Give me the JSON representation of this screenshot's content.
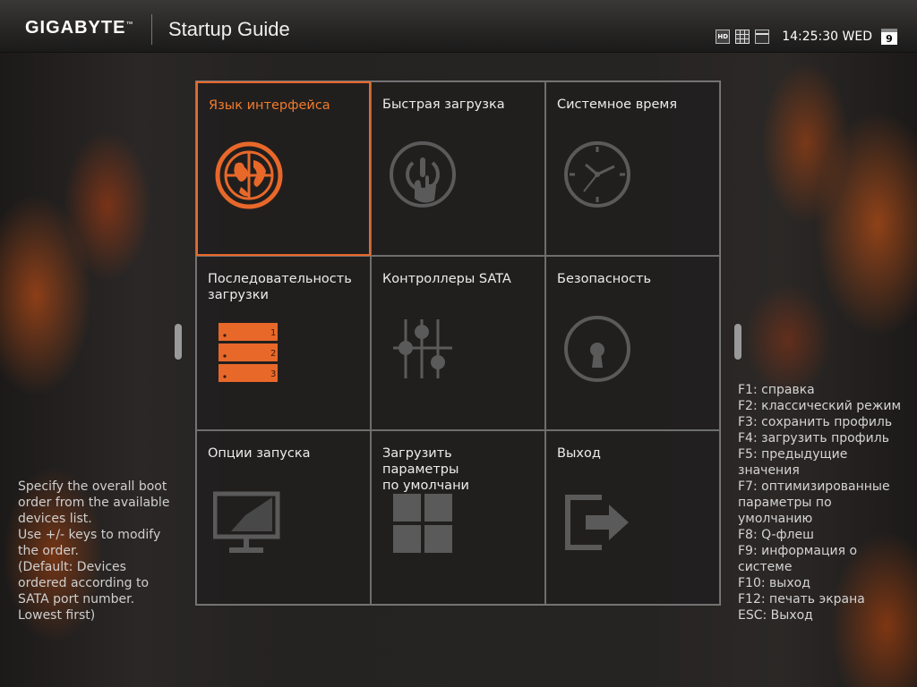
{
  "header": {
    "brand": "GIGABYTE",
    "brand_mark": "™",
    "title": "Startup Guide",
    "clock": "14:25:30 WED",
    "day": "9",
    "icons": [
      "hd-icon",
      "grid-view-icon",
      "window-view-icon",
      "calendar-icon"
    ]
  },
  "tiles": [
    {
      "label": "Язык интерфейса",
      "icon": "globe-icon"
    },
    {
      "label": "Быстрая загрузка",
      "icon": "power-touch-icon"
    },
    {
      "label": "Системное время",
      "icon": "clock-icon"
    },
    {
      "label": "Последовательность загрузки",
      "icon": "boot-order-icon",
      "order": [
        "1",
        "2",
        "3"
      ]
    },
    {
      "label": "Контроллеры SATA",
      "icon": "sliders-icon"
    },
    {
      "label": "Безопасность",
      "icon": "keyhole-icon"
    },
    {
      "label": "Опции запуска",
      "icon": "monitor-icon"
    },
    {
      "label": "Загрузить\nпараметры\nпо умолчани",
      "icon": "windows-icon"
    },
    {
      "label": "Выход",
      "icon": "exit-icon"
    }
  ],
  "help_text": "Specify the overall boot\norder from the available\ndevices list.\nUse +/- keys to modify\nthe order.\n(Default: Devices\nordered according to\nSATA port number.\nLowest first)",
  "hotkeys": [
    "F1: справка",
    "F2: классический режим",
    "F3: сохранить профиль",
    "F4: загрузить профиль",
    "F5: предыдущие\nзначения",
    "F7: оптимизированные\nпараметры по\nумолчанию",
    "F8: Q-флеш",
    "F9: информация о\nсистеме",
    "F10: выход",
    "F12: печать экрана",
    "ESC: Выход"
  ],
  "colors": {
    "accent": "#e8682a",
    "icon_gray": "#5a5a5a",
    "text": "#ececec"
  }
}
